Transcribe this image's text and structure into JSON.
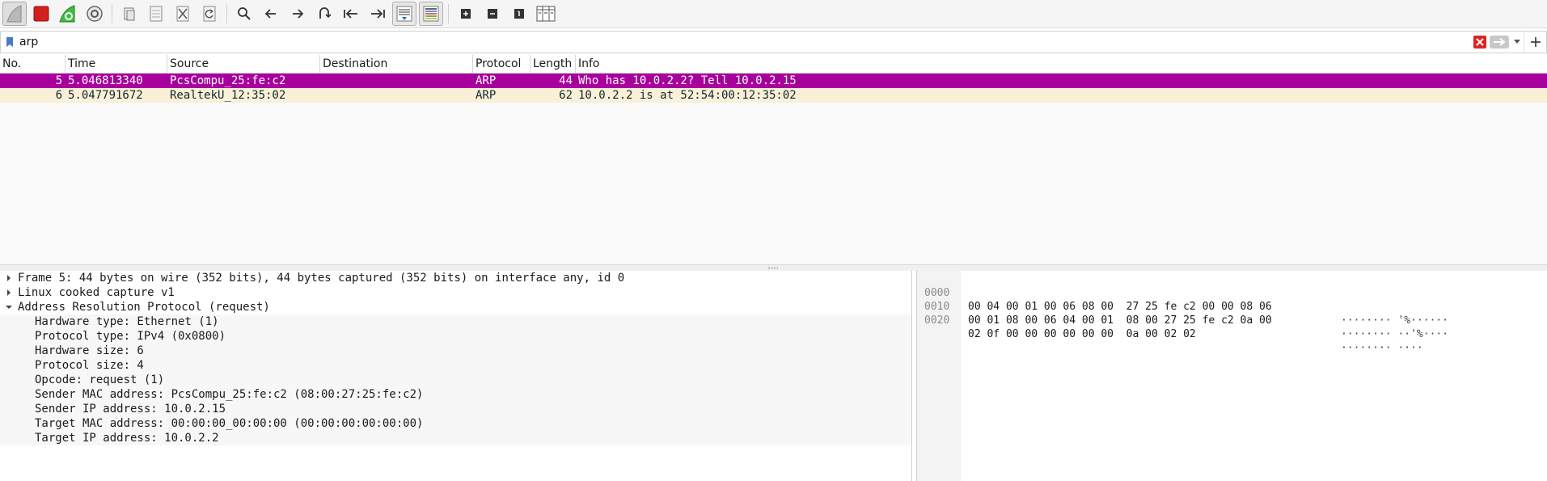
{
  "toolbar": {
    "buttons": [
      {
        "name": "start-capture-icon"
      },
      {
        "name": "stop-capture-icon",
        "color": "#d41f1f"
      },
      {
        "name": "restart-capture-icon",
        "color": "#2aa12a"
      },
      {
        "name": "capture-options-icon"
      },
      {
        "name": "open-file-icon"
      },
      {
        "name": "save-file-icon"
      },
      {
        "name": "close-file-icon"
      },
      {
        "name": "reload-file-icon"
      },
      {
        "name": "find-packet-icon"
      },
      {
        "name": "go-back-icon"
      },
      {
        "name": "go-forward-icon"
      },
      {
        "name": "go-to-packet-icon"
      },
      {
        "name": "go-first-packet-icon"
      },
      {
        "name": "go-last-packet-icon"
      },
      {
        "name": "autoscroll-icon"
      },
      {
        "name": "colorize-icon"
      },
      {
        "name": "zoom-in-icon"
      },
      {
        "name": "zoom-out-icon"
      },
      {
        "name": "normal-size-icon"
      },
      {
        "name": "resize-columns-icon"
      }
    ]
  },
  "filter": {
    "value": "arp"
  },
  "packet_list": {
    "columns": [
      "No.",
      "Time",
      "Source",
      "Destination",
      "Protocol",
      "Length",
      "Info"
    ],
    "rows": [
      {
        "no": "5",
        "time": "5.046813340",
        "source": "PcsCompu_25:fe:c2",
        "destination": "",
        "protocol": "ARP",
        "length": "44",
        "info": "Who has 10.0.2.2? Tell 10.0.2.15",
        "selected": true
      },
      {
        "no": "6",
        "time": "5.047791672",
        "source": "RealtekU_12:35:02",
        "destination": "",
        "protocol": "ARP",
        "length": "62",
        "info": "10.0.2.2 is at 52:54:00:12:35:02",
        "selected": false
      }
    ],
    "colors": {
      "selected_bg": "#a8009d",
      "arp_bg": "#faf0d7"
    }
  },
  "details": {
    "tree": [
      {
        "text": "Frame 5: 44 bytes on wire (352 bits), 44 bytes captured (352 bits) on interface any, id 0",
        "expanded": false
      },
      {
        "text": "Linux cooked capture v1",
        "expanded": false
      },
      {
        "text": "Address Resolution Protocol (request)",
        "expanded": true
      }
    ],
    "arp_fields": [
      "Hardware type: Ethernet (1)",
      "Protocol type: IPv4 (0x0800)",
      "Hardware size: 6",
      "Protocol size: 4",
      "Opcode: request (1)",
      "Sender MAC address: PcsCompu_25:fe:c2 (08:00:27:25:fe:c2)",
      "Sender IP address: 10.0.2.15",
      "Target MAC address: 00:00:00_00:00:00 (00:00:00:00:00:00)",
      "Target IP address: 10.0.2.2"
    ]
  },
  "bytes": {
    "rows": [
      {
        "offset": "0000",
        "hex": "00 04 00 01 00 06 08 00  27 25 fe c2 00 00 08 06",
        "ascii": "········ '%······"
      },
      {
        "offset": "0010",
        "hex": "00 01 08 00 06 04 00 01  08 00 27 25 fe c2 0a 00",
        "ascii": "········ ··'%····"
      },
      {
        "offset": "0020",
        "hex": "02 0f 00 00 00 00 00 00  0a 00 02 02",
        "ascii": "········ ····"
      }
    ]
  }
}
